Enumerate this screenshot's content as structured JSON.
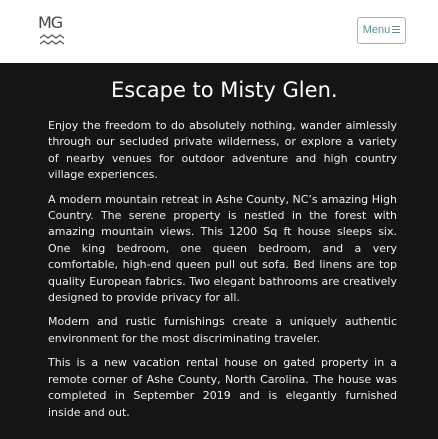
{
  "header": {
    "logo_text": "MG",
    "menu_label": "Menu"
  },
  "main": {
    "title": "Escape to Misty Glen.",
    "paragraphs": [
      "Enjoy the freedom to do absolutely nothing, wander aimlessly through our secluded private wilderness, or explore a variety of nearby venues for outdoor adventure and high country village experiences.",
      "A modern mountain retreat in Ashe County, NC’s amazing High Country. The serene property is nestled in the forest with amazing mountain views. This 1200 Sq ft house sleeps six. One king bedroom, one queen bedroom, and a very comfortable, high-end queen pull out sofa. Bed linens are top quality European fabrics. Two elegant bathrooms are creatively designed to provide privacy for all.",
      "Modern and rustic furnishings create a uniquely authentic environment for the most discriminating traveler.",
      "This is a new vacation rental house on gated property in a remote corner of Ashe County, North Carolina. The house was completed in September 2019 and is elegantly furnished inside and out."
    ]
  }
}
